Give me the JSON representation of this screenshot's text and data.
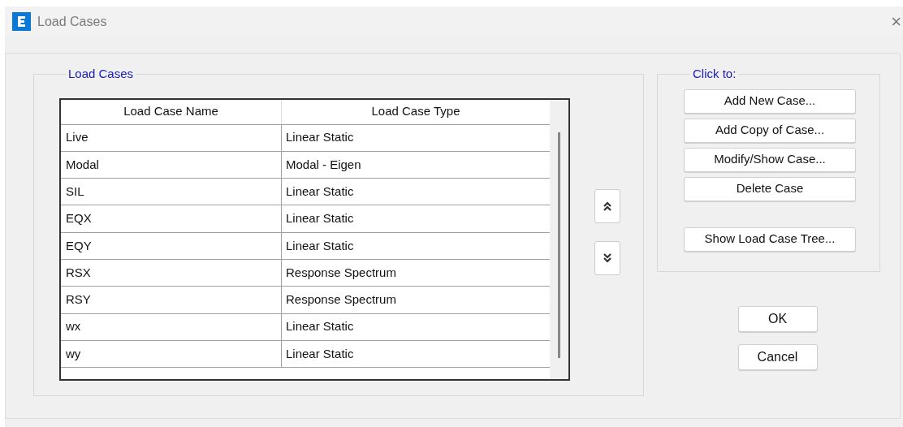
{
  "window": {
    "title": "Load Cases",
    "close": "×"
  },
  "load_cases": {
    "title": "Load Cases",
    "columns": [
      "Load Case Name",
      "Load Case Type"
    ],
    "rows": [
      {
        "name": "Live",
        "type": "Linear Static"
      },
      {
        "name": "Modal",
        "type": "Modal - Eigen"
      },
      {
        "name": "SIL",
        "type": "Linear Static"
      },
      {
        "name": "EQX",
        "type": "Linear Static"
      },
      {
        "name": "EQY",
        "type": "Linear Static"
      },
      {
        "name": "RSX",
        "type": "Response Spectrum"
      },
      {
        "name": "RSY",
        "type": "Response Spectrum"
      },
      {
        "name": "wx",
        "type": "Linear Static"
      },
      {
        "name": "wy",
        "type": "Linear Static"
      }
    ]
  },
  "click_to": {
    "title": "Click to:",
    "buttons": [
      {
        "label": "Add New Case..."
      },
      {
        "label": "Add Copy of Case..."
      },
      {
        "label": "Modify/Show Case..."
      },
      {
        "label": "Delete Case"
      }
    ],
    "tree_button": "Show Load Case Tree..."
  },
  "buttons": [
    "OK",
    "Cancel"
  ]
}
